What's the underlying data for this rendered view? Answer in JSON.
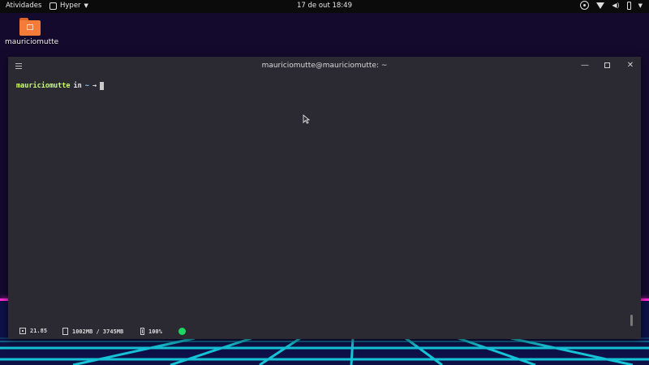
{
  "topbar": {
    "activities": "Atividades",
    "app_name": "Hyper",
    "clock": "17 de out  18:49"
  },
  "desktop": {
    "home_icon_label": "mauriciomutte"
  },
  "terminal": {
    "title": "mauriciomutte@mauriciomutte: ~",
    "prompt_user": "mauriciomutte",
    "prompt_in": "in",
    "prompt_cwd": "~",
    "prompt_arrow": "→",
    "status": {
      "cpu": "21.85",
      "memory": "1002MB / 3745MB",
      "battery": "100%"
    }
  },
  "colors": {
    "terminal_bg": "#2b2a33",
    "prompt_user": "#c8ff66",
    "prompt_cwd": "#7ec8ff",
    "horizon": "#ff2bd6",
    "grid": "#18d6e6",
    "folder": "#f57c38",
    "spotify": "#1ed760"
  }
}
